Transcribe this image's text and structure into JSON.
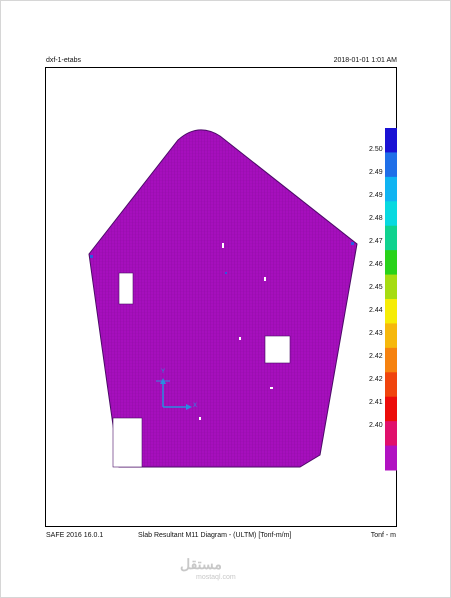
{
  "header": {
    "model_name": "dxf-1-etabs",
    "datetime": "2018-01-01 1:01 AM"
  },
  "footer": {
    "program": "SAFE 2016 16.0.1",
    "diagram_title": "Slab Resultant M11 Diagram - (ULTM)  [Tonf-m/m]",
    "units": "Tonf - m"
  },
  "legend": {
    "values": [
      "2.50",
      "2.49",
      "2.49",
      "2.48",
      "2.47",
      "2.46",
      "2.45",
      "2.44",
      "2.43",
      "2.42",
      "2.42",
      "2.41",
      "2.40"
    ],
    "colors": [
      "#1a12d4",
      "#1f6fe8",
      "#10b4f2",
      "#08d9e0",
      "#10d28f",
      "#29d21a",
      "#a6dc12",
      "#f6ec06",
      "#f6b80c",
      "#f6820f",
      "#f0440d",
      "#ec0c0a",
      "#e0106c",
      "#b112c2"
    ]
  },
  "axes": {
    "x_label": "X",
    "y_label": "Y"
  },
  "colors": {
    "slab_fill": "#a60fbd",
    "slab_grid": "#7a0a8c",
    "axis": "#2a8ce0"
  },
  "watermark": {
    "arabic": "مستقل",
    "latin": "mostaql.com"
  }
}
